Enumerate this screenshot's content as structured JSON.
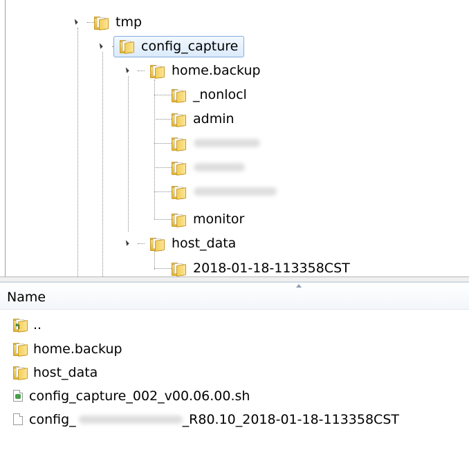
{
  "tree": {
    "nodes": [
      {
        "id": "tmp",
        "label": "tmp"
      },
      {
        "id": "config_capture",
        "label": "config_capture"
      },
      {
        "id": "home_backup",
        "label": "home.backup"
      },
      {
        "id": "nonlocl",
        "label": "_nonlocl"
      },
      {
        "id": "admin",
        "label": "admin"
      },
      {
        "id": "redacted1",
        "label": ""
      },
      {
        "id": "redacted2",
        "label": ""
      },
      {
        "id": "redacted3",
        "label": ""
      },
      {
        "id": "monitor",
        "label": "monitor"
      },
      {
        "id": "host_data",
        "label": "host_data"
      },
      {
        "id": "host_data_child",
        "label": "2018-01-18-113358CST"
      }
    ]
  },
  "list": {
    "header": {
      "name": "Name"
    },
    "rows": [
      {
        "label": "..",
        "icon": "up-folder-icon"
      },
      {
        "label": "home.backup",
        "icon": "folder-icon"
      },
      {
        "label": "host_data",
        "icon": "folder-icon"
      },
      {
        "label": "config_capture_002_v00.06.00.sh",
        "icon": "script-file-icon"
      },
      {
        "label_prefix": "config_",
        "label_suffix": "_R80.10_2018-01-18-113358CST",
        "icon": "file-icon"
      }
    ]
  }
}
